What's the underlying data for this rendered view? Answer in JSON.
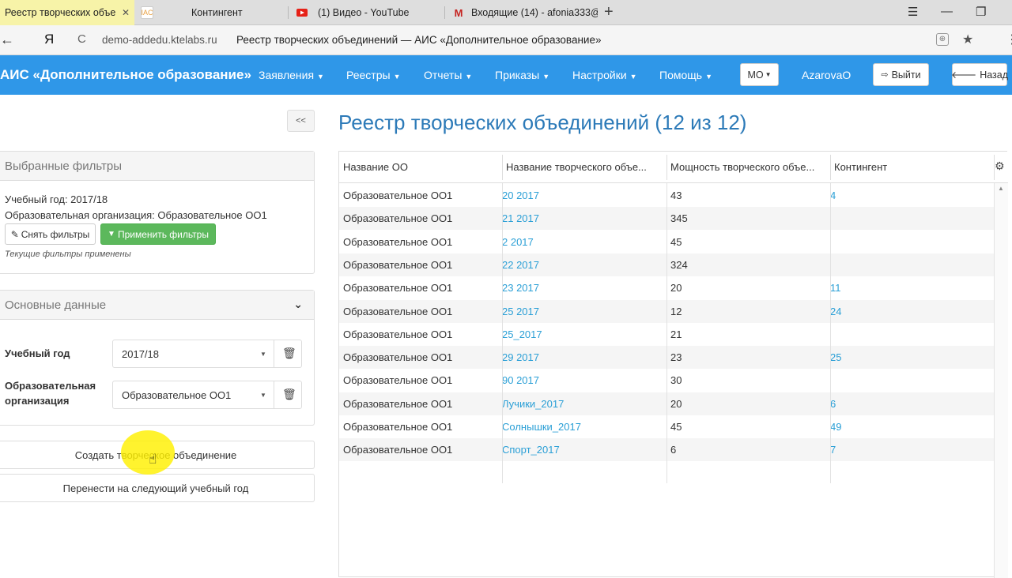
{
  "browser": {
    "tabs": [
      {
        "title": "Реестр творческих объе",
        "icon": "site-favicon",
        "active": true
      },
      {
        "title": "Контингент",
        "icon": "ais-favicon",
        "active": false
      },
      {
        "title": "(1) Видео - YouTube",
        "icon": "youtube-icon",
        "active": false
      },
      {
        "title": "Входящие (14) - afonia333@",
        "icon": "gmail-icon",
        "active": false
      }
    ],
    "ais_favicon_text": "IAC",
    "url_host": "demo-addedu.ktelabs.ru",
    "page_title": "Реестр творческих объединений — АИС «Дополнительное образование»",
    "logo_text": "Я"
  },
  "navbar": {
    "brand": "АИС «Дополнительное образование»",
    "menu": [
      {
        "label": "Заявления"
      },
      {
        "label": "Реестры"
      },
      {
        "label": "Отчеты"
      },
      {
        "label": "Приказы"
      },
      {
        "label": "Настройки"
      },
      {
        "label": "Помощь"
      }
    ],
    "mo_label": "МО",
    "user": "AzarovaO",
    "logout_label": "Выйти",
    "back_label": "Назад",
    "color": "#2f97e8"
  },
  "sidebar": {
    "collapse_label": "<<",
    "filters": {
      "title": "Выбранные фильтры",
      "year_line": "Учебный год: 2017/18",
      "org_line": "Образовательная организация: Образовательное ОО1",
      "clear_label": "Снять фильтры",
      "apply_label": "Применить фильтры",
      "note": "Текущие фильтры применены"
    },
    "main_data": {
      "title": "Основные данные",
      "year_label": "Учебный год",
      "year_value": "2017/18",
      "org_label_1": "Образовательная",
      "org_label_2": "организация",
      "org_value": "Образовательное ОО1"
    },
    "create_label": "Создать творческое объединение",
    "transfer_label": "Перенести на следующий учебный год"
  },
  "main": {
    "title": "Реестр творческих объединений (12 из 12)",
    "columns": [
      "Название ОО",
      "Название творческого объе...",
      "Мощность творческого объе...",
      "Контингент"
    ],
    "rows": [
      {
        "org": "Образовательное ОО1",
        "name": "20 2017",
        "capacity": "43",
        "contingent": "4"
      },
      {
        "org": "Образовательное ОО1",
        "name": "21 2017",
        "capacity": "345",
        "contingent": ""
      },
      {
        "org": "Образовательное ОО1",
        "name": "2 2017",
        "capacity": "45",
        "contingent": ""
      },
      {
        "org": "Образовательное ОО1",
        "name": "22 2017",
        "capacity": "324",
        "contingent": ""
      },
      {
        "org": "Образовательное ОО1",
        "name": "23 2017",
        "capacity": "20",
        "contingent": "11"
      },
      {
        "org": "Образовательное ОО1",
        "name": "25 2017",
        "capacity": "12",
        "contingent": "24"
      },
      {
        "org": "Образовательное ОО1",
        "name": "25_2017",
        "capacity": "21",
        "contingent": ""
      },
      {
        "org": "Образовательное ОО1",
        "name": "29 2017",
        "capacity": "23",
        "contingent": "25"
      },
      {
        "org": "Образовательное ОО1",
        "name": "90 2017",
        "capacity": "30",
        "contingent": ""
      },
      {
        "org": "Образовательное ОО1",
        "name": "Лучики_2017",
        "capacity": "20",
        "contingent": "6"
      },
      {
        "org": "Образовательное ОО1",
        "name": "Солнышки_2017",
        "capacity": "45",
        "contingent": "49"
      },
      {
        "org": "Образовательное ОО1",
        "name": "Спорт_2017",
        "capacity": "6",
        "contingent": "7"
      }
    ]
  }
}
